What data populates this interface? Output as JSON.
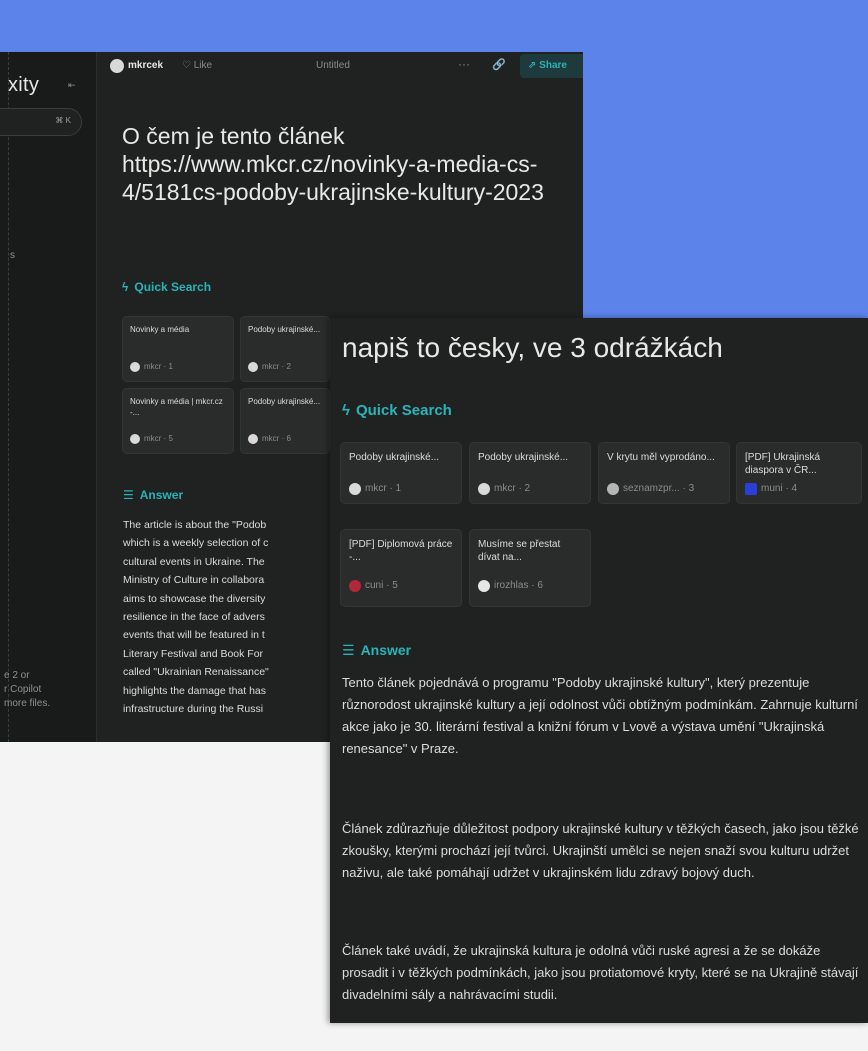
{
  "window1": {
    "brand": "xity",
    "collapse_icon": "collapse-icon",
    "newthread_kbd": "K",
    "sidebar_fragments": [
      "s",
      "e 2 or",
      "r Copilot",
      "more files."
    ],
    "topbar": {
      "username": "mkrcek",
      "like_label": "Like",
      "title": "Untitled",
      "share_label": "Share"
    },
    "question": "O čem je tento článek https://www.mkcr.cz/novinky-a-media-cs-4/5181cs-podoby-ukrajinske-kultury-2023",
    "quick_search_label": "Quick Search",
    "sources": [
      {
        "title": "Novinky a média",
        "source": "mkcr · 1"
      },
      {
        "title": "Podoby ukrajinské...",
        "source": "mkcr · 2"
      },
      {
        "title": "Novinky a média | mkcr.cz -...",
        "source": "mkcr · 5"
      },
      {
        "title": "Podoby ukrajinské...",
        "source": "mkcr · 6"
      }
    ],
    "answer_label": "Answer",
    "answer_lines": [
      "The article is about the \"Podob",
      "which is a weekly selection of c",
      "cultural events in Ukraine. The",
      "Ministry of Culture in collabora",
      "aims to showcase the diversity",
      "resilience in the face of advers",
      "events that will be featured in t",
      "Literary Festival and Book For",
      "called \"Ukrainian Renaissance\"",
      "highlights the damage that has",
      "infrastructure during the Russi"
    ]
  },
  "window2": {
    "question": "napiš to česky, ve 3 odrážkách",
    "quick_search_label": "Quick Search",
    "sources": [
      {
        "title": "Podoby ukrajinské...",
        "source": "mkcr · 1",
        "fav_color": "#d9d9d9"
      },
      {
        "title": "Podoby ukrajinské...",
        "source": "mkcr · 2",
        "fav_color": "#d9d9d9"
      },
      {
        "title": "V krytu měl vyprodáno...",
        "source": "seznamzpr... · 3",
        "fav_color": "#b5b5b5"
      },
      {
        "title": "[PDF] Ukrajinská diaspora v ČR...",
        "source": "muni · 4",
        "fav_color": "#2a3fd8"
      },
      {
        "title": "[PDF] Diplomová práce -...",
        "source": "cuni · 5",
        "fav_color": "#b2283b"
      },
      {
        "title": "Musíme se přestat dívat na...",
        "source": "irozhlas · 6",
        "fav_color": "#e6e6e6"
      }
    ],
    "answer_label": "Answer",
    "paragraphs": [
      "Tento článek pojednává o programu \"Podoby ukrajinské kultury\", který prezentuje různorodost ukrajinské kultury a její odolnost vůči obtížným podmínkám. Zahrnuje kulturní akce jako je 30. literární festival a knižní fórum v Lvově a výstava umění \"Ukrajinská renesance\" v Praze.",
      "Článek zdůrazňuje důležitost podpory ukrajinské kultury v těžkých časech, jako jsou těžké zkoušky, kterými prochází její tvůrci. Ukrajinští umělci se nejen snaží svou kulturu udržet naživu, ale také pomáhají udržet v ukrajinském lidu zdravý bojový duch.",
      "Článek také uvádí, že ukrajinská kultura je odolná vůči ruské agresi a že se dokáže prosadit i v těžkých podmínkách, jako jsou protiatomové kryty, které se na Ukrajině stávají divadelními sály a nahrávacími studii."
    ]
  },
  "colors": {
    "background_blue": "#5b83ea",
    "panel_dark": "#202222",
    "sidebar_dark": "#191a1a",
    "accent_teal": "#2ab3b8",
    "text_primary": "#e8e8e6",
    "text_muted": "#8a8d8d"
  }
}
